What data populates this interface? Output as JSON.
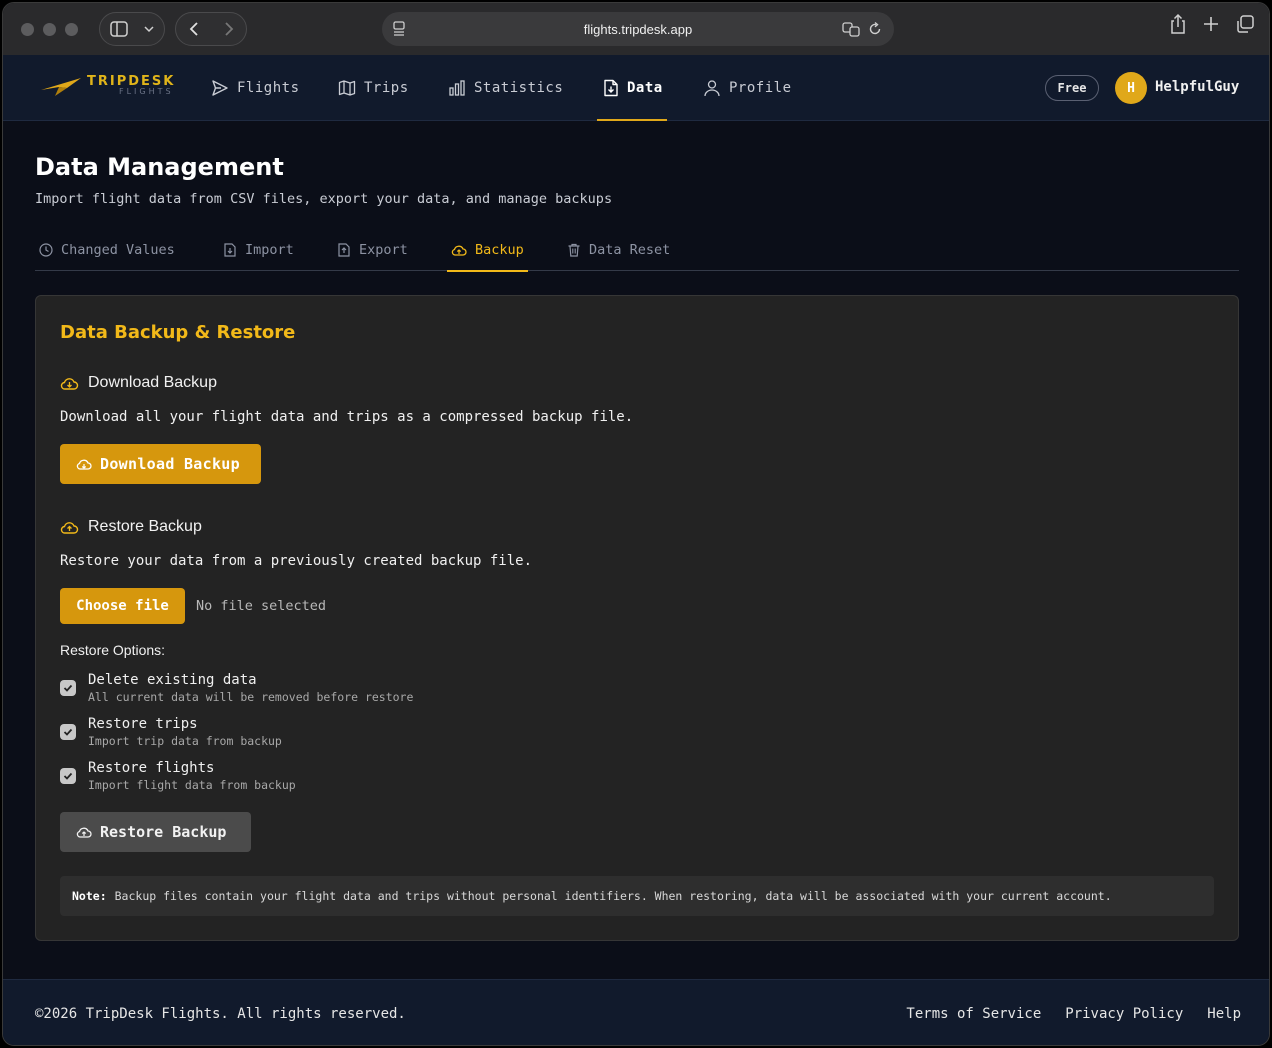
{
  "browser": {
    "url": "flights.tripdesk.app"
  },
  "brand": {
    "name": "TRIPDESK",
    "sub": "FLIGHTS",
    "accent": "#e0a81a"
  },
  "nav": {
    "items": [
      {
        "label": "Flights",
        "icon": "send-icon"
      },
      {
        "label": "Trips",
        "icon": "map-icon"
      },
      {
        "label": "Statistics",
        "icon": "bar-chart-icon"
      },
      {
        "label": "Data",
        "icon": "file-download-icon",
        "active": true
      },
      {
        "label": "Profile",
        "icon": "user-icon"
      }
    ],
    "plan_badge": "Free",
    "avatar_initial": "H",
    "username": "HelpfulGuy"
  },
  "page": {
    "title": "Data Management",
    "subtitle": "Import flight data from CSV files, export your data, and manage backups",
    "tabs": [
      {
        "label": "Changed Values",
        "icon": "clock-icon"
      },
      {
        "label": "Import",
        "icon": "file-import-icon"
      },
      {
        "label": "Export",
        "icon": "file-export-icon"
      },
      {
        "label": "Backup",
        "icon": "cloud-icon",
        "active": true
      },
      {
        "label": "Data Reset",
        "icon": "trash-icon"
      }
    ]
  },
  "backup": {
    "card_title": "Data Backup & Restore",
    "download": {
      "heading": "Download Backup",
      "description": "Download all your flight data and trips as a compressed backup file.",
      "button": "Download Backup"
    },
    "restore": {
      "heading": "Restore Backup",
      "description": "Restore your data from a previously created backup file.",
      "choose_file": "Choose file",
      "no_file": "No file selected",
      "options_label": "Restore Options:",
      "options": [
        {
          "title": "Delete existing data",
          "desc": "All current data will be removed before restore",
          "checked": true
        },
        {
          "title": "Restore trips",
          "desc": "Import trip data from backup",
          "checked": true
        },
        {
          "title": "Restore flights",
          "desc": "Import flight data from backup",
          "checked": true
        }
      ],
      "button": "Restore Backup"
    },
    "note_label": "Note:",
    "note_text": "Backup files contain your flight data and trips without personal identifiers. When restoring, data will be associated with your current account."
  },
  "footer": {
    "copyright": "©2026 TripDesk Flights. All rights reserved.",
    "links": [
      "Terms of Service",
      "Privacy Policy",
      "Help"
    ]
  }
}
